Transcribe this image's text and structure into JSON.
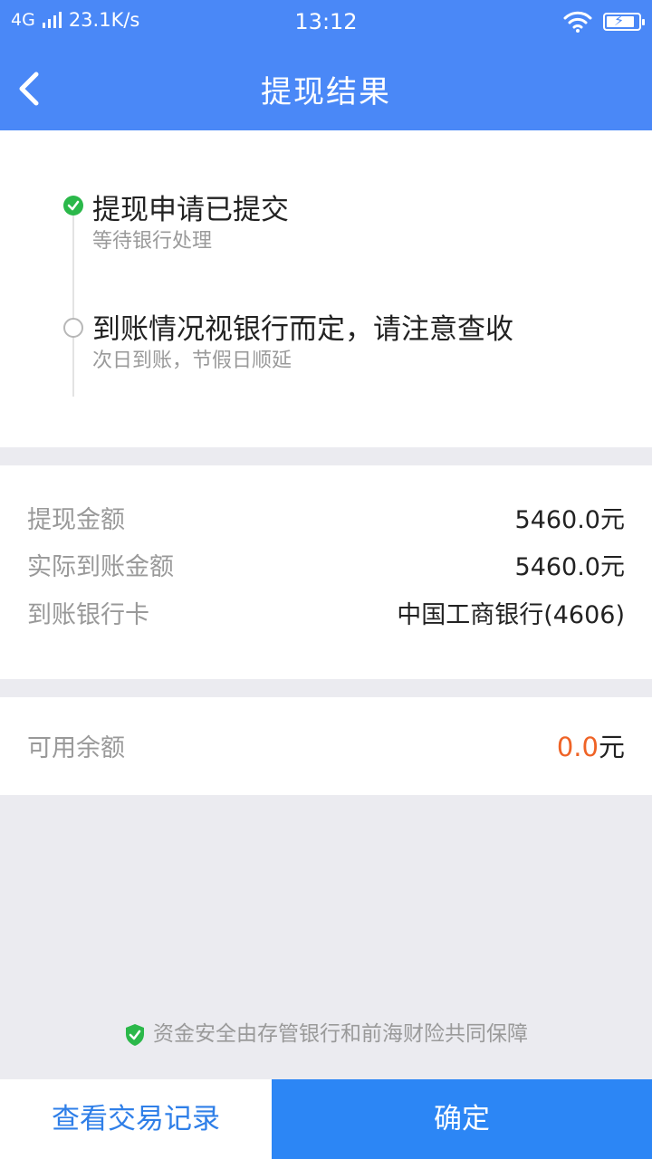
{
  "status_bar": {
    "network": "4G",
    "speed": "23.1K/s",
    "time": "13:12"
  },
  "nav": {
    "title": "提现结果"
  },
  "steps": [
    {
      "title": "提现申请已提交",
      "subtitle": "等待银行处理",
      "status": "done"
    },
    {
      "title": "到账情况视银行而定，请注意查收",
      "subtitle": "次日到账，节假日顺延",
      "status": "pending"
    }
  ],
  "details": [
    {
      "label": "提现金额",
      "value": "5460.0元"
    },
    {
      "label": "实际到账金额",
      "value": "5460.0元"
    },
    {
      "label": "到账银行卡",
      "value": "中国工商银行(4606)"
    }
  ],
  "balance": {
    "label": "可用余额",
    "amount": "0.0",
    "unit": "元"
  },
  "security_note": "资金安全由存管银行和前海财险共同保障",
  "buttons": {
    "records": "查看交易记录",
    "confirm": "确定"
  },
  "colors": {
    "primary": "#4a88f7",
    "confirm": "#2c86f5",
    "success": "#2bb84a",
    "accent": "#ef6326"
  },
  "icons": {
    "back": "chevron-left-icon",
    "wifi": "wifi-icon",
    "battery": "battery-charging-icon",
    "shield": "shield-check-icon"
  }
}
